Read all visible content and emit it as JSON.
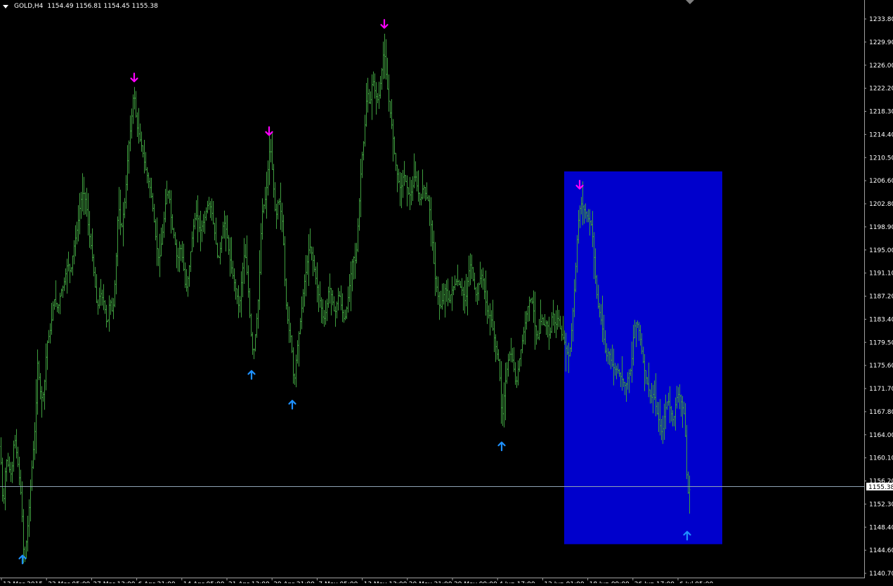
{
  "header": {
    "symbol_timeframe": "GOLD,H4",
    "ohlc": "1154.49 1156.81 1154.45 1155.38"
  },
  "colors": {
    "background": "#000000",
    "bars": "#3f9f3f",
    "down_arrow": "#ff00ff",
    "up_arrow": "#1e90ff",
    "highlight": "#0000cc",
    "bid_line": "#8fa3b5",
    "axis_text": "#ffffff"
  },
  "chart_data": {
    "type": "bar",
    "title": "GOLD,H4",
    "price_ticks": [
      "1233.80",
      "1229.90",
      "1226.00",
      "1222.20",
      "1218.30",
      "1214.40",
      "1210.50",
      "1206.60",
      "1202.80",
      "1198.90",
      "1195.00",
      "1191.10",
      "1187.20",
      "1183.40",
      "1179.50",
      "1175.60",
      "1171.70",
      "1167.80",
      "1164.00",
      "1160.10",
      "1156.20",
      "1152.30",
      "1148.40",
      "1144.60",
      "1140.70"
    ],
    "ylim": [
      1140.7,
      1235.2
    ],
    "current_price": "1155.38",
    "time_labels": [
      "13 Mar 2015",
      "23 Mar 05:00",
      "27 Mar 13:00",
      "6 Apr 21:00",
      "14 Apr 05:00",
      "21 Apr 13:00",
      "29 Apr 21:00",
      "7 May 05:00",
      "13 May 13:00",
      "20 May 21:00",
      "29 May 09:00",
      "4 Jun 17:00",
      "12 Jun 01:00",
      "18 Jun 09:00",
      "26 Jun 17:00",
      "6 Jul 05:00"
    ],
    "path": [
      [
        0,
        1162
      ],
      [
        4,
        1151
      ],
      [
        8,
        1160
      ],
      [
        16,
        1157
      ],
      [
        20,
        1164
      ],
      [
        26,
        1158
      ],
      [
        30,
        1153
      ],
      [
        34,
        1142
      ],
      [
        40,
        1150
      ],
      [
        44,
        1157
      ],
      [
        50,
        1166
      ],
      [
        53,
        1176
      ],
      [
        58,
        1170
      ],
      [
        62,
        1171
      ],
      [
        66,
        1179
      ],
      [
        72,
        1182
      ],
      [
        76,
        1187
      ],
      [
        82,
        1185
      ],
      [
        86,
        1188
      ],
      [
        90,
        1189
      ],
      [
        96,
        1193
      ],
      [
        100,
        1191
      ],
      [
        104,
        1195
      ],
      [
        110,
        1199
      ],
      [
        114,
        1203
      ],
      [
        118,
        1205
      ],
      [
        122,
        1203
      ],
      [
        126,
        1198
      ],
      [
        130,
        1195
      ],
      [
        134,
        1190
      ],
      [
        138,
        1185
      ],
      [
        142,
        1188
      ],
      [
        148,
        1186
      ],
      [
        152,
        1182
      ],
      [
        156,
        1187
      ],
      [
        160,
        1184
      ],
      [
        164,
        1191
      ],
      [
        168,
        1203
      ],
      [
        172,
        1198
      ],
      [
        178,
        1204
      ],
      [
        182,
        1212
      ],
      [
        186,
        1216
      ],
      [
        190,
        1222
      ],
      [
        194,
        1216
      ],
      [
        198,
        1214
      ],
      [
        202,
        1212
      ],
      [
        206,
        1209
      ],
      [
        210,
        1207
      ],
      [
        214,
        1205
      ],
      [
        218,
        1201
      ],
      [
        222,
        1196
      ],
      [
        226,
        1193
      ],
      [
        232,
        1199
      ],
      [
        236,
        1204
      ],
      [
        240,
        1205
      ],
      [
        244,
        1199
      ],
      [
        248,
        1197
      ],
      [
        252,
        1193
      ],
      [
        256,
        1196
      ],
      [
        260,
        1193
      ],
      [
        264,
        1188
      ],
      [
        268,
        1191
      ],
      [
        272,
        1196
      ],
      [
        276,
        1200
      ],
      [
        280,
        1201
      ],
      [
        284,
        1198
      ],
      [
        290,
        1200
      ],
      [
        296,
        1203
      ],
      [
        300,
        1202
      ],
      [
        306,
        1197
      ],
      [
        310,
        1193
      ],
      [
        314,
        1196
      ],
      [
        318,
        1200
      ],
      [
        322,
        1198
      ],
      [
        326,
        1194
      ],
      [
        332,
        1190
      ],
      [
        336,
        1188
      ],
      [
        340,
        1185
      ],
      [
        344,
        1191
      ],
      [
        348,
        1195
      ],
      [
        352,
        1190
      ],
      [
        356,
        1182
      ],
      [
        360,
        1177
      ],
      [
        364,
        1182
      ],
      [
        368,
        1188
      ],
      [
        372,
        1201
      ],
      [
        378,
        1204
      ],
      [
        384,
        1213
      ],
      [
        388,
        1207
      ],
      [
        392,
        1200
      ],
      [
        396,
        1204
      ],
      [
        402,
        1199
      ],
      [
        406,
        1187
      ],
      [
        410,
        1182
      ],
      [
        414,
        1180
      ],
      [
        418,
        1172
      ],
      [
        422,
        1178
      ],
      [
        428,
        1184
      ],
      [
        432,
        1189
      ],
      [
        436,
        1192
      ],
      [
        440,
        1196
      ],
      [
        444,
        1194
      ],
      [
        448,
        1191
      ],
      [
        452,
        1188
      ],
      [
        456,
        1186
      ],
      [
        460,
        1183
      ],
      [
        464,
        1185
      ],
      [
        468,
        1189
      ],
      [
        472,
        1187
      ],
      [
        476,
        1184
      ],
      [
        482,
        1188
      ],
      [
        486,
        1185
      ],
      [
        490,
        1183
      ],
      [
        494,
        1186
      ],
      [
        498,
        1190
      ],
      [
        502,
        1194
      ],
      [
        506,
        1193
      ],
      [
        510,
        1201
      ],
      [
        514,
        1210
      ],
      [
        518,
        1214
      ],
      [
        522,
        1222
      ],
      [
        526,
        1219
      ],
      [
        530,
        1224
      ],
      [
        534,
        1221
      ],
      [
        538,
        1220
      ],
      [
        542,
        1224
      ],
      [
        546,
        1229
      ],
      [
        550,
        1223
      ],
      [
        554,
        1219
      ],
      [
        558,
        1215
      ],
      [
        562,
        1210
      ],
      [
        566,
        1207
      ],
      [
        570,
        1205
      ],
      [
        574,
        1208
      ],
      [
        578,
        1206
      ],
      [
        582,
        1204
      ],
      [
        586,
        1205
      ],
      [
        590,
        1208
      ],
      [
        594,
        1205
      ],
      [
        598,
        1203
      ],
      [
        602,
        1206
      ],
      [
        606,
        1204
      ],
      [
        610,
        1203
      ],
      [
        614,
        1198
      ],
      [
        618,
        1191
      ],
      [
        622,
        1188
      ],
      [
        626,
        1185
      ],
      [
        630,
        1187
      ],
      [
        634,
        1189
      ],
      [
        638,
        1186
      ],
      [
        642,
        1188
      ],
      [
        646,
        1189
      ],
      [
        650,
        1190
      ],
      [
        654,
        1189
      ],
      [
        658,
        1188
      ],
      [
        662,
        1186
      ],
      [
        666,
        1191
      ],
      [
        670,
        1193
      ],
      [
        674,
        1189
      ],
      [
        678,
        1187
      ],
      [
        682,
        1190
      ],
      [
        686,
        1191
      ],
      [
        690,
        1187
      ],
      [
        694,
        1184
      ],
      [
        698,
        1184
      ],
      [
        702,
        1181
      ],
      [
        706,
        1178
      ],
      [
        710,
        1176
      ],
      [
        714,
        1166
      ],
      [
        718,
        1172
      ],
      [
        722,
        1176
      ],
      [
        726,
        1178
      ],
      [
        730,
        1176
      ],
      [
        734,
        1172
      ],
      [
        738,
        1176
      ],
      [
        742,
        1179
      ],
      [
        746,
        1182
      ],
      [
        750,
        1185
      ],
      [
        754,
        1187
      ],
      [
        758,
        1186
      ],
      [
        762,
        1181
      ],
      [
        766,
        1180
      ],
      [
        770,
        1184
      ],
      [
        774,
        1182
      ],
      [
        778,
        1183
      ],
      [
        782,
        1180
      ],
      [
        786,
        1185
      ],
      [
        790,
        1182
      ],
      [
        794,
        1184
      ],
      [
        798,
        1181
      ],
      [
        802,
        1180
      ],
      [
        806,
        1178
      ],
      [
        810,
        1177
      ],
      [
        814,
        1183
      ],
      [
        818,
        1190
      ],
      [
        822,
        1199
      ],
      [
        826,
        1203
      ],
      [
        830,
        1202
      ],
      [
        834,
        1201
      ],
      [
        838,
        1200
      ],
      [
        842,
        1199
      ],
      [
        846,
        1192
      ],
      [
        850,
        1186
      ],
      [
        854,
        1184
      ],
      [
        858,
        1181
      ],
      [
        862,
        1177
      ],
      [
        866,
        1178
      ],
      [
        870,
        1176
      ],
      [
        874,
        1175
      ],
      [
        878,
        1175
      ],
      [
        882,
        1174
      ],
      [
        886,
        1173
      ],
      [
        890,
        1172
      ],
      [
        894,
        1174
      ],
      [
        898,
        1175
      ],
      [
        902,
        1182
      ],
      [
        906,
        1183
      ],
      [
        910,
        1181
      ],
      [
        914,
        1177
      ],
      [
        918,
        1174
      ],
      [
        922,
        1172
      ],
      [
        926,
        1170
      ],
      [
        930,
        1171
      ],
      [
        934,
        1168
      ],
      [
        938,
        1166
      ],
      [
        942,
        1164
      ],
      [
        946,
        1168
      ],
      [
        950,
        1170
      ],
      [
        954,
        1168
      ],
      [
        958,
        1166
      ],
      [
        962,
        1170
      ],
      [
        966,
        1171
      ],
      [
        970,
        1169
      ],
      [
        974,
        1167
      ],
      [
        978,
        1154
      ],
      [
        982,
        1155
      ]
    ],
    "down_arrows": [
      [
        191,
        1223
      ],
      [
        383,
        1214
      ],
      [
        547,
        1232
      ],
      [
        825,
        1205
      ]
    ],
    "up_arrows": [
      [
        32,
        1144
      ],
      [
        358,
        1175
      ],
      [
        416,
        1170
      ],
      [
        714,
        1163
      ],
      [
        978,
        1148
      ]
    ],
    "highlight_zone": {
      "x_start": 803,
      "x_end": 1028,
      "y_high": 1208.2,
      "y_low": 1145.6
    },
    "grid": false
  }
}
